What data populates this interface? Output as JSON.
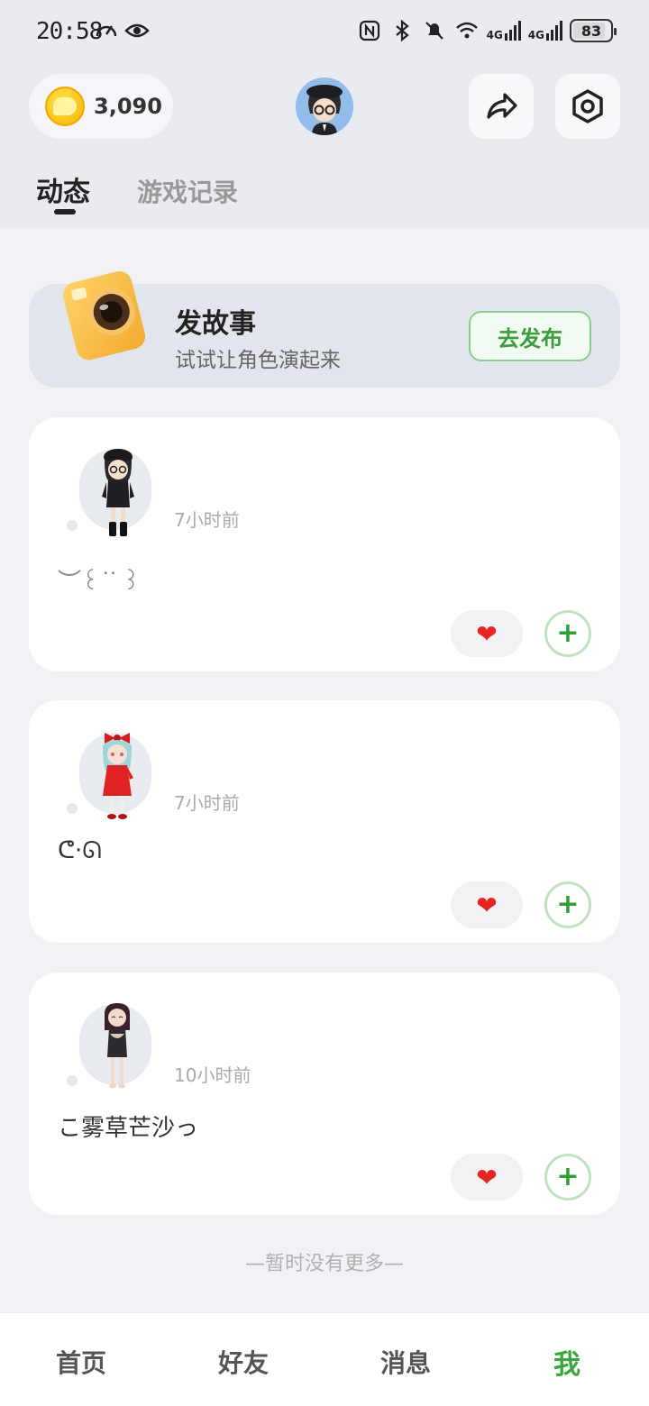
{
  "status_bar": {
    "time": "20:58",
    "network_1": "4G",
    "network_2": "4G",
    "battery": "83"
  },
  "header": {
    "coins": "3,090"
  },
  "tabs": [
    {
      "label": "动态",
      "active": true
    },
    {
      "label": "游戏记录",
      "active": false
    }
  ],
  "publish_card": {
    "title": "发故事",
    "subtitle": "试试让角色演起来",
    "button_label": "去发布"
  },
  "posts": [
    {
      "time": "7小时前",
      "text": "︶꒰ ͘ ͘ ꒱",
      "character": "black-outfit-glasses"
    },
    {
      "time": "7小时前",
      "text": "ᕦ·ᘏ",
      "character": "red-bow-dress"
    },
    {
      "time": "10小时前",
      "text": "こ雾草芒沙っ",
      "character": "dark-hair-mini-dress"
    }
  ],
  "footer_text": "—暂时没有更多—",
  "bottom_nav": {
    "items": [
      {
        "label": "首页",
        "active": false
      },
      {
        "label": "好友",
        "active": false
      },
      {
        "label": "消息",
        "active": false
      },
      {
        "label": "我",
        "active": true
      }
    ]
  },
  "colors": {
    "accent_green": "#3aa73e",
    "like_red": "#e62424"
  }
}
